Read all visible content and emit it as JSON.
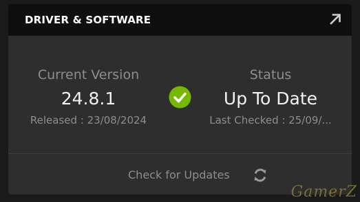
{
  "card": {
    "title": "DRIVER & SOFTWARE",
    "expand_icon": "arrow-up-right-icon"
  },
  "version": {
    "label": "Current Version",
    "value": "24.8.1",
    "released": "Released : 23/08/2024"
  },
  "status": {
    "label": "Status",
    "value": "Up To Date",
    "last_checked": "Last Checked : 25/09/...",
    "icon": "check-circle-icon",
    "icon_color": "#76b900"
  },
  "footer": {
    "check_label": "Check for Updates",
    "refresh_icon": "refresh-icon"
  },
  "watermark": {
    "text": "GamerZ"
  }
}
